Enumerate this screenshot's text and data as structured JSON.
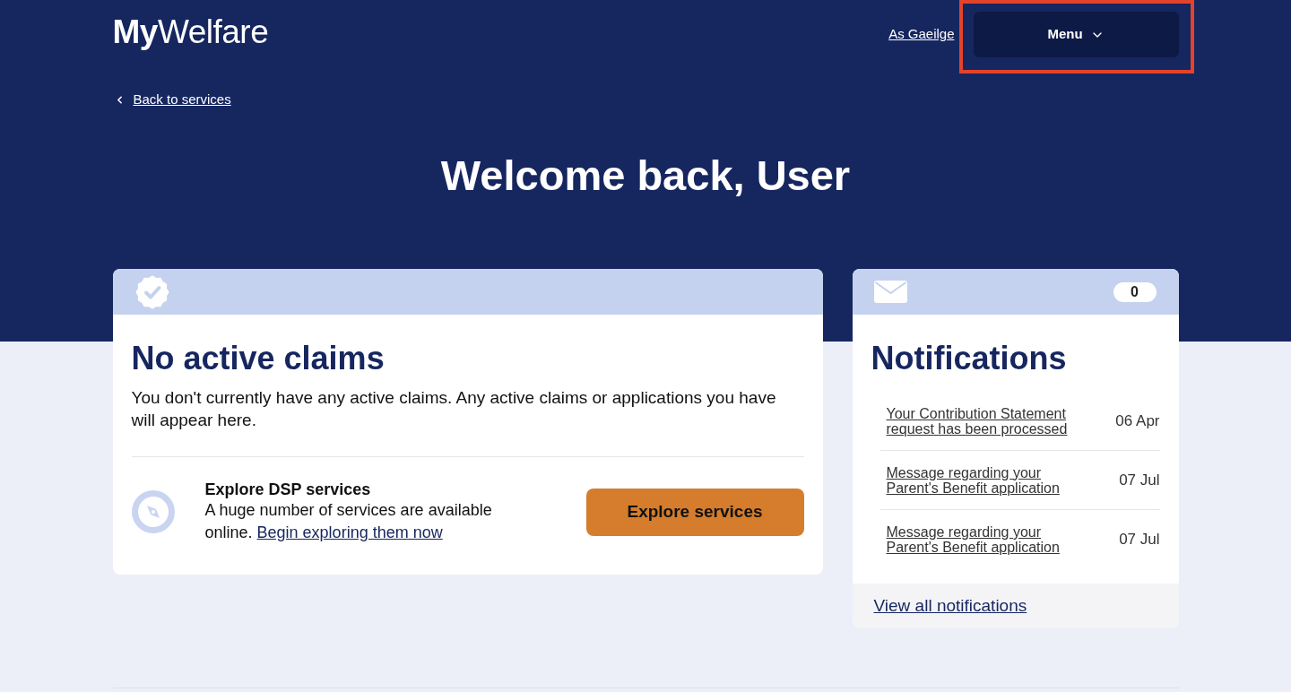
{
  "header": {
    "logo": "**My**Welfare",
    "language_link": "As Gaeilge",
    "menu_button": {
      "label": "Menu",
      "highlighted": true
    },
    "back_link": "Back to services",
    "title": "Welcome back, User"
  },
  "claims_card": {
    "title": "No active claims",
    "description": "You don't currently have any active claims. Any active claims or applications you have will appear here.",
    "explore": {
      "title": "Explore DSP services",
      "text": "A huge number of services are available online.",
      "link": "Begin exploring them now",
      "button": "Explore services"
    }
  },
  "notifications_card": {
    "count": "0",
    "title": "Notifications",
    "items": [
      {
        "text": "Your Contribution Statement request has been processed",
        "date": "06 Apr"
      },
      {
        "text": "Message regarding your Parent's Benefit application",
        "date": "07 Jul"
      },
      {
        "text": "Message regarding your Parent's Benefit application",
        "date": "07 Jul"
      }
    ],
    "view_all_link": "View all notifications"
  }
}
